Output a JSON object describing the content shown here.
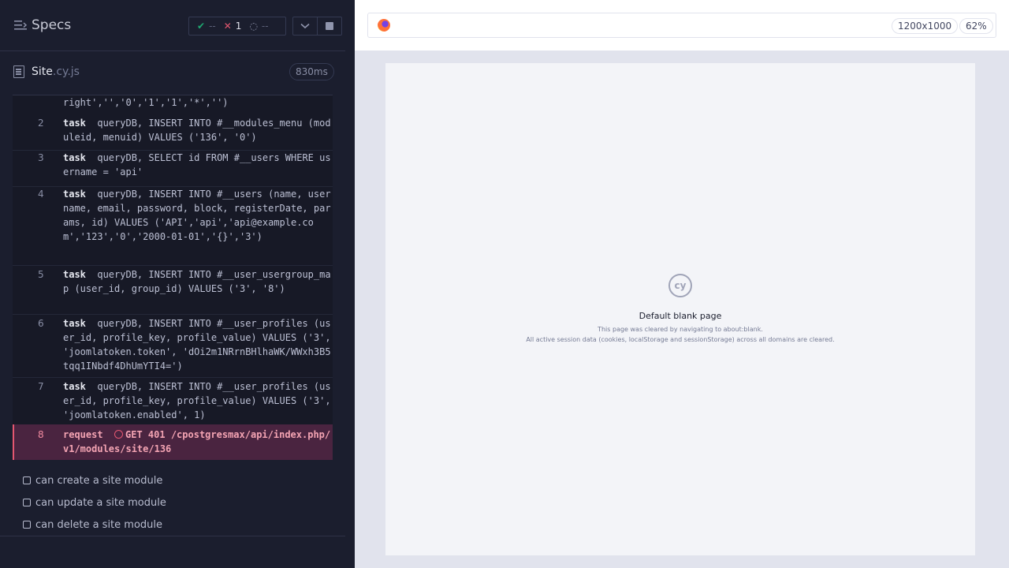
{
  "reporter": {
    "title": "Specs",
    "stats": {
      "passed": "--",
      "failed": "1",
      "pending": "--"
    },
    "spec_file": {
      "name": "Site",
      "ext": ".cy.js",
      "duration": "830ms"
    },
    "commands": [
      {
        "num": "",
        "kw": "",
        "text": "right','','0','1','1','*','')"
      },
      {
        "num": "2",
        "kw": "task",
        "text": "queryDB, INSERT INTO #__modules_menu (moduleid, menuid) VALUES ('136', '0')"
      },
      {
        "num": "3",
        "kw": "task",
        "text": "queryDB, SELECT id FROM #__users WHERE username = 'api'"
      },
      {
        "num": "4",
        "kw": "task",
        "text": "queryDB, INSERT INTO #__users (name, username, email, password, block, registerDate, params, id) VALUES ('API','api','api@example.com','123','0','2000-01-01','{}','3')"
      },
      {
        "num": "5",
        "kw": "task",
        "text": "queryDB, INSERT INTO #__user_usergroup_map (user_id, group_id) VALUES ('3', '8')"
      },
      {
        "num": "6",
        "kw": "task",
        "text": "queryDB, INSERT INTO #__user_profiles (user_id, profile_key, profile_value) VALUES ('3', 'joomlatoken.token', 'dOi2m1NRrnBHlhaWK/WWxh3B5tqq1INbdf4DhUmYTI4=')"
      },
      {
        "num": "7",
        "kw": "task",
        "text": "queryDB, INSERT INTO #__user_profiles (user_id, profile_key, profile_value) VALUES ('3', 'joomlatoken.enabled', 1)"
      },
      {
        "num": "8",
        "kw": "request",
        "text": "GET 401 /cpostgresmax/api/index.php/v1/modules/site/136"
      }
    ],
    "tests": [
      "can create a site module",
      "can update a site module",
      "can delete a site module"
    ]
  },
  "app": {
    "viewport": "1200x1000",
    "zoom": "62%",
    "blank_page": {
      "logo": "cy",
      "title": "Default blank page",
      "line1": "This page was cleared by navigating to about:blank.",
      "line2": "All active session data (cookies, localStorage and sessionStorage) across all domains are cleared."
    }
  },
  "colors": {
    "passed": "#1fa971",
    "failed": "#e45770",
    "panel": "#1b1e2e"
  }
}
